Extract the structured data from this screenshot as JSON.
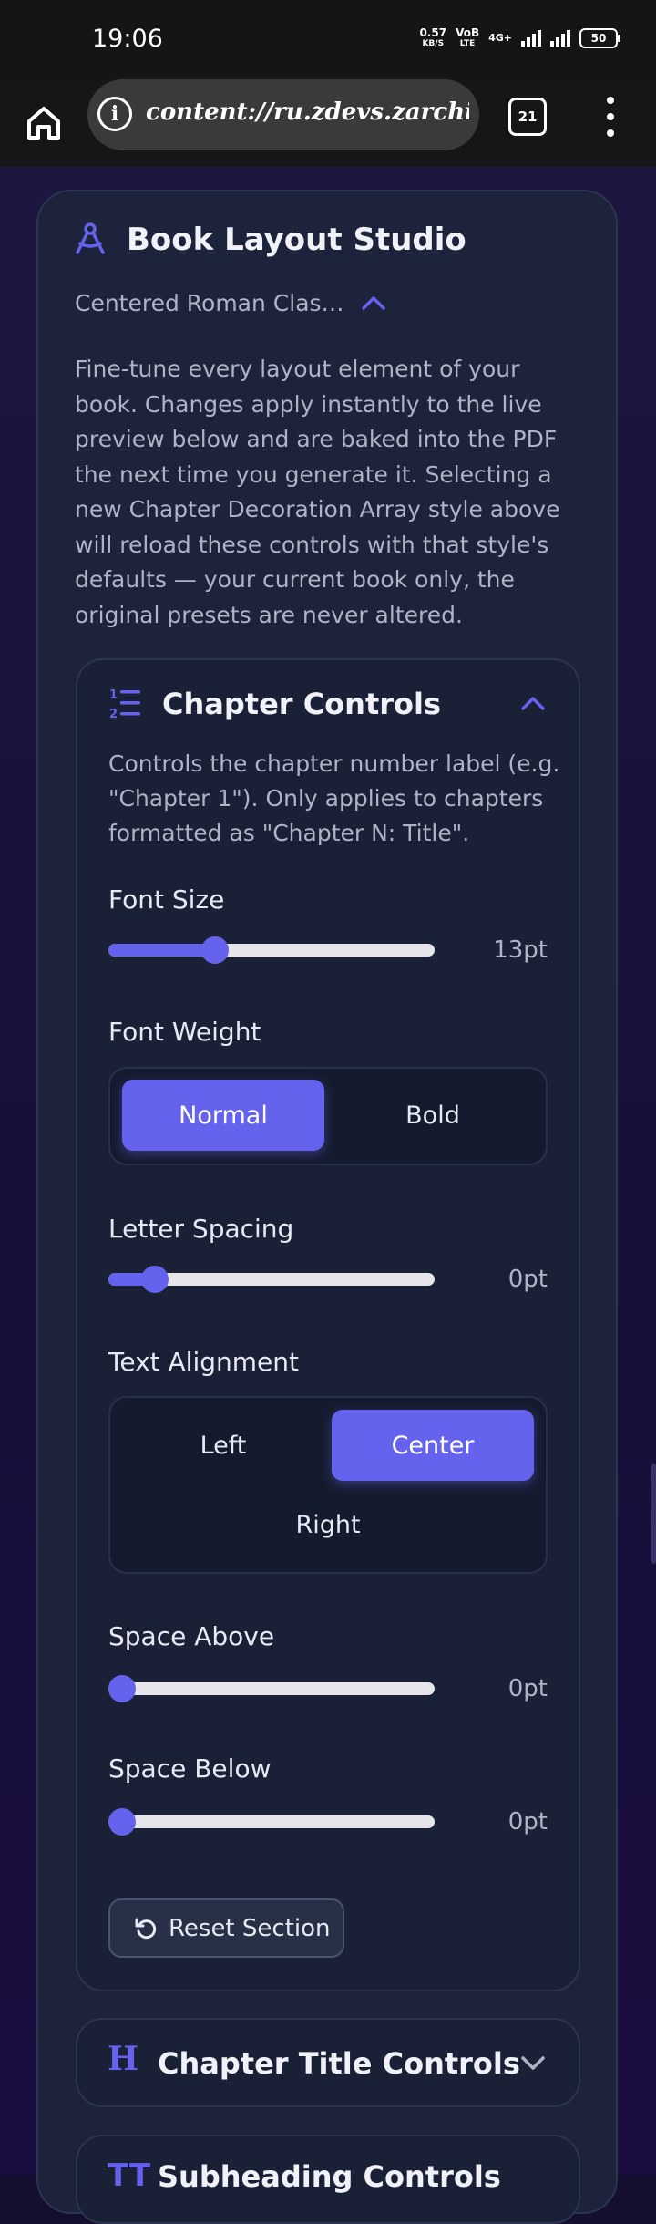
{
  "status_bar": {
    "time": "19:06",
    "speed_value": "0.57",
    "speed_unit": "KB/S",
    "volte_top": "VoB",
    "volte_bottom": "LTE",
    "network": "4G+",
    "battery": "50"
  },
  "browser": {
    "url": "content://ru.zdevs.zarchive",
    "tab_count": "21"
  },
  "studio": {
    "title": "Book Layout Studio",
    "preset_name": "Centered Roman Clas…",
    "description": "Fine-tune every layout element of your book. Changes apply instantly to the live preview below and are baked into the PDF the next time you generate it. Selecting a new Chapter Decoration Array style above will reload these controls with that style's defaults — your current book only, the original presets are never altered."
  },
  "chapter_controls": {
    "title": "Chapter Controls",
    "description": "Controls the chapter number label (e.g. \"Chapter 1\"). Only applies to chapters formatted as \"Chapter N: Title\".",
    "font_size": {
      "label": "Font Size",
      "value": "13pt",
      "fraction": 0.31
    },
    "font_weight": {
      "label": "Font Weight",
      "options": [
        "Normal",
        "Bold"
      ],
      "selected": "Normal"
    },
    "letter_spacing": {
      "label": "Letter Spacing",
      "value": "0pt",
      "fraction": 0.11
    },
    "text_alignment": {
      "label": "Text Alignment",
      "options": [
        "Left",
        "Center",
        "Right"
      ],
      "selected": "Center"
    },
    "space_above": {
      "label": "Space Above",
      "value": "0pt",
      "fraction": 0.0
    },
    "space_below": {
      "label": "Space Below",
      "value": "0pt",
      "fraction": 0.0
    },
    "reset_label": "Reset Section"
  },
  "collapsed_sections": {
    "chapter_title": "Chapter Title Controls",
    "subheading": "Subheading Controls"
  },
  "colors": {
    "accent": "#6563ee",
    "card": "#1c233a",
    "background": "#170f3a"
  }
}
